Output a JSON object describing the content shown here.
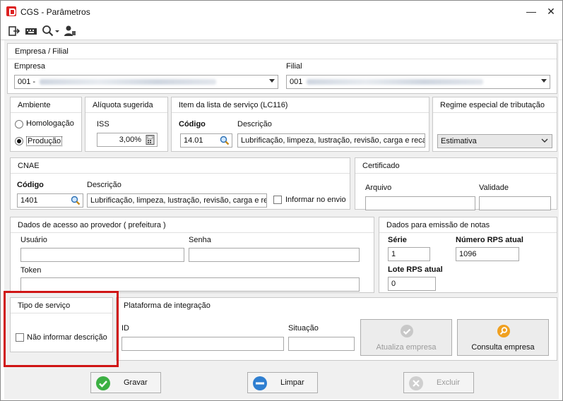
{
  "window": {
    "title": "CGS - Parâmetros"
  },
  "titlebar_buttons": {
    "minimize": "—",
    "close": "✕"
  },
  "toolbar": {
    "icons": [
      "exit-icon",
      "keyboard-icon",
      "search-dropdown-icon",
      "user-icon"
    ]
  },
  "empresa_filial": {
    "title": "Empresa / Filial",
    "empresa_label": "Empresa",
    "empresa_value": "001 -",
    "filial_label": "Filial",
    "filial_value": "001"
  },
  "ambiente": {
    "title": "Ambiente",
    "options": [
      "Homologação",
      "Produção"
    ],
    "selected": "Produção"
  },
  "aliquota": {
    "title": "Alíquota sugerida",
    "iss_label": "ISS",
    "iss_value": "3,00%"
  },
  "item_lista": {
    "title": "Item da lista de serviço (LC116)",
    "codigo_label": "Código",
    "codigo_value": "14.01",
    "descricao_label": "Descrição",
    "descricao_value": "Lubrificação, limpeza, lustração, revisão, carga e reca"
  },
  "regime": {
    "title": "Regime especial de tributação",
    "value": "Estimativa"
  },
  "cnae": {
    "title": "CNAE",
    "codigo_label": "Código",
    "codigo_value": "1401",
    "descricao_label": "Descrição",
    "descricao_value": "Lubrificação, limpeza, lustração, revisão, carga e re",
    "informar_label": "Informar no envio"
  },
  "certificado": {
    "title": "Certificado",
    "arquivo_label": "Arquivo",
    "validade_label": "Validade"
  },
  "acesso": {
    "title": "Dados de acesso ao provedor ( prefeitura )",
    "usuario_label": "Usuário",
    "senha_label": "Senha",
    "token_label": "Token"
  },
  "emissao": {
    "title": "Dados para emissão de notas",
    "serie_label": "Série",
    "serie_value": "1",
    "rps_label": "Número RPS atual",
    "rps_value": "1096",
    "lote_label": "Lote RPS atual",
    "lote_value": "0"
  },
  "tipo_servico": {
    "title": "Tipo de serviço",
    "nao_informar_label": "Não informar descrição"
  },
  "plataforma": {
    "title": "Plataforma de integração",
    "id_label": "ID",
    "situacao_label": "Situação",
    "atualiza_label": "Atualiza empresa",
    "consulta_label": "Consulta empresa"
  },
  "footer": {
    "gravar": "Gravar",
    "limpar": "Limpar",
    "excluir": "Excluir"
  },
  "colors": {
    "highlight": "#d01515",
    "gravar_green": "#3cb043",
    "limpar_blue": "#2f7fd1",
    "consulta_orange": "#f0a020"
  }
}
